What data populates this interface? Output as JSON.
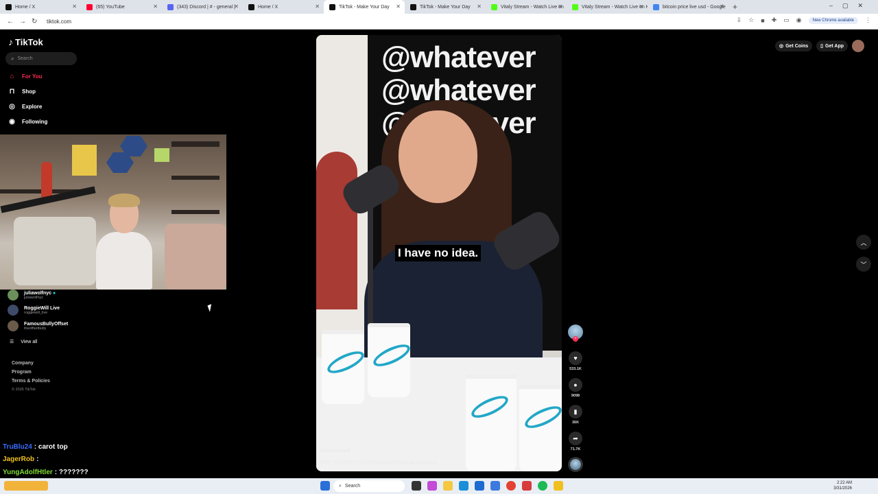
{
  "browser": {
    "tabs": [
      {
        "title": "Home / X",
        "color": "#111111"
      },
      {
        "title": "(65) YouTube",
        "color": "#ff0033"
      },
      {
        "title": "(343) Discord | # - general |",
        "color": "#5865f2"
      },
      {
        "title": "Home / X",
        "color": "#111111"
      },
      {
        "title": "TikTok - Make Your Day",
        "color": "#111111"
      },
      {
        "title": "TikTok - Make Your Day",
        "color": "#111111"
      },
      {
        "title": "Vitaly Stream - Watch Live on",
        "color": "#53fc18"
      },
      {
        "title": "Vitaly Stream - Watch Live on K",
        "color": "#53fc18"
      },
      {
        "title": "bitcoin price live usd - Google",
        "color": "#4285f4"
      }
    ],
    "url": "tiktok.com",
    "new_chrome_label": "New Chrome available"
  },
  "sidebar": {
    "logo": "TikTok",
    "search_placeholder": "Search",
    "nav": [
      {
        "label": "For You",
        "icon": "home-icon",
        "color": "#fe2c55"
      },
      {
        "label": "Shop",
        "icon": "shop-bag-icon",
        "color": "#ffffff"
      },
      {
        "label": "Explore",
        "icon": "compass-icon",
        "color": "#ffffff"
      },
      {
        "label": "Following",
        "icon": "following-avatar-icon",
        "color": "#ffffff"
      }
    ],
    "following_accounts": [
      {
        "name": "juliawolfnyc",
        "handle": "juliawolfnyc",
        "verified": true
      },
      {
        "name": "RoggieWill Live",
        "handle": "roggiewill_live",
        "verified": false
      },
      {
        "name": "FamousBullyOffset",
        "handle": "theoffsetbully",
        "verified": false
      }
    ],
    "view_all": "View all",
    "footer_links": [
      "Company",
      "Program",
      "Terms & Policies"
    ],
    "copyright": "© 2026 TikTok"
  },
  "chat": [
    {
      "user": "TruBlu24",
      "user_color": "#3a6cff",
      "message": ": carot top"
    },
    {
      "user": "JagerRob",
      "user_color": "#f0c020",
      "message": ":"
    },
    {
      "user": "YungAdolfHtler",
      "user_color": "#7fdc2f",
      "message": ": ???????"
    }
  ],
  "video": {
    "wall_text": "@whatever",
    "caption": "I have no idea.",
    "username": "whateverpod",
    "description": "EASY QUESTIONS FAIL?!?! Whatever Podcast with Brian Atlas"
  },
  "actions": {
    "likes": "533.1K",
    "comments": "9098",
    "saves": "36K",
    "shares": "71.7K"
  },
  "top_right": {
    "get_coins": "Get Coins",
    "get_app": "Get App"
  },
  "taskbar": {
    "search": "Search",
    "time": "2:22 AM",
    "date": "3/31/2026"
  }
}
